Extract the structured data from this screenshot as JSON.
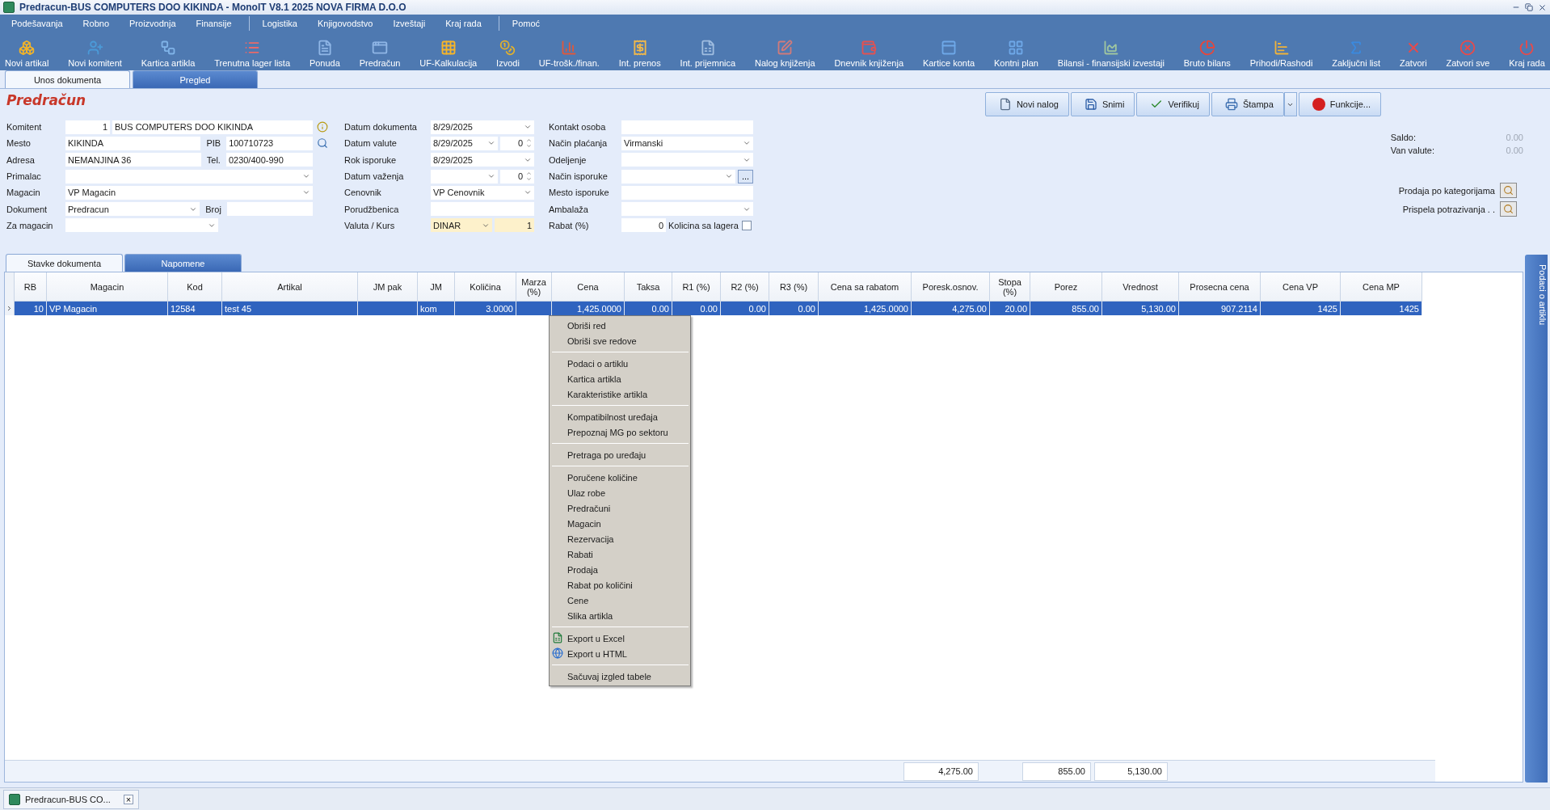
{
  "window": {
    "title": "Predracun-BUS COMPUTERS DOO KIKINDA - MonoIT V8.1 2025 NOVA FIRMA D.O.O"
  },
  "menu": [
    "Podešavanja",
    "Robno",
    "Proizvodnja",
    "Finansije",
    "Logistika",
    "Knjigovodstvo",
    "Izveštaji",
    "Kraj rada",
    "Pomoć"
  ],
  "toolbar": [
    "Novi artikal",
    "Novi komitent",
    "Kartica artikla",
    "Trenutna lager lista",
    "Ponuda",
    "Predračun",
    "UF-Kalkulacija",
    "Izvodi",
    "UF-trošk./finan.",
    "Int. prenos",
    "Int. prijemnica",
    "Nalog knjiženja",
    "Dnevnik knjiženja",
    "Kartice konta",
    "Kontni plan",
    "Bilansi - finansijski izvestaji",
    "Bruto bilans",
    "Prihodi/Rashodi",
    "Zaključni list",
    "Zatvori",
    "Zatvori sve",
    "Kraj rada"
  ],
  "tabs": [
    {
      "label": "Unos dokumenta",
      "selected": true
    },
    {
      "label": "Pregled",
      "selected": false
    }
  ],
  "form": {
    "title": "Predračun",
    "columns": [
      [
        {
          "label": "Komitent",
          "parts": [
            {
              "kind": "number",
              "value": "1",
              "highlighted": false
            },
            {
              "kind": "text",
              "value": "BUS COMPUTERS DOO KIKINDA",
              "highlighted": false
            }
          ]
        },
        {
          "label": "Mesto",
          "parts": [
            {
              "kind": "text",
              "value": "KIKINDA",
              "highlighted": false
            },
            {
              "kind": "label",
              "text": "PIB"
            },
            {
              "kind": "text",
              "value": "100710723",
              "highlighted": false
            }
          ]
        },
        {
          "label": "Adresa",
          "parts": [
            {
              "kind": "text",
              "value": "NEMANJINA 36",
              "highlighted": false
            },
            {
              "kind": "label",
              "text": "Tel."
            },
            {
              "kind": "text",
              "value": "0230/400-990",
              "highlighted": false
            }
          ]
        },
        {
          "label": "Primalac",
          "parts": [
            {
              "kind": "dropdown",
              "highlighted": false
            }
          ]
        },
        {
          "label": "Magacin",
          "parts": [
            {
              "kind": "dropdown",
              "value": "VP Magacin",
              "highlighted": false
            }
          ]
        },
        {
          "label": "Dokument",
          "parts": [
            {
              "kind": "dropdown",
              "value": "Predracun",
              "highlighted": false
            },
            {
              "kind": "label",
              "text": "Broj"
            },
            {
              "kind": "text",
              "highlighted": false
            }
          ]
        },
        {
          "label": "Za magacin",
          "parts": [
            {
              "kind": "dropdown",
              "highlighted": false
            },
            {
              "kind": "gap"
            }
          ]
        }
      ],
      [
        {
          "label": "Datum dokumenta",
          "parts": [
            {
              "kind": "dropdown",
              "value": "8/29/2025",
              "highlighted": false
            }
          ]
        },
        {
          "label": "Datum valute",
          "parts": [
            {
              "kind": "dropdown",
              "value": "8/29/2025",
              "highlighted": false
            },
            {
              "kind": "spinner",
              "value": "0",
              "highlighted": false
            }
          ]
        },
        {
          "label": "Rok isporuke",
          "parts": [
            {
              "kind": "dropdown",
              "value": "8/29/2025",
              "highlighted": false
            }
          ]
        },
        {
          "label": "Datum važenja",
          "parts": [
            {
              "kind": "dropdown",
              "highlighted": false
            },
            {
              "kind": "spinner",
              "value": "0",
              "highlighted": false
            }
          ]
        },
        {
          "label": "Cenovnik",
          "parts": [
            {
              "kind": "dropdown",
              "value": "VP Cenovnik",
              "highlighted": false
            }
          ]
        },
        {
          "label": "Porudžbenica",
          "parts": [
            {
              "kind": "text",
              "highlighted": false
            }
          ]
        },
        {
          "label": "Valuta / Kurs",
          "parts": [
            {
              "kind": "dropdown",
              "value": "DINAR",
              "highlighted": true
            },
            {
              "kind": "number",
              "value": "1",
              "highlighted": true
            }
          ]
        }
      ],
      [
        {
          "label": "Kontakt osoba",
          "parts": [
            {
              "kind": "text",
              "highlighted": false
            }
          ]
        },
        {
          "label": "Način plaćanja",
          "parts": [
            {
              "kind": "dropdown",
              "value": "Virmanski",
              "highlighted": false
            }
          ]
        },
        {
          "label": "Odeljenje",
          "parts": [
            {
              "kind": "dropdown",
              "highlighted": false
            }
          ]
        },
        {
          "label": "Način isporuke",
          "parts": [
            {
              "kind": "dropdown",
              "highlighted": false
            },
            {
              "kind": "button",
              "text": "..."
            }
          ]
        },
        {
          "label": "Mesto isporuke",
          "parts": [
            {
              "kind": "text",
              "highlighted": false
            }
          ]
        },
        {
          "label": "Ambalaža",
          "parts": [
            {
              "kind": "dropdown",
              "highlighted": false
            }
          ]
        },
        {
          "label": "Rabat (%)",
          "parts": [
            {
              "kind": "number",
              "value": "0",
              "highlighted": false
            },
            {
              "kind": "checkbox",
              "text": "Kolicina sa lagera",
              "checked": false
            }
          ]
        }
      ]
    ]
  },
  "actions": [
    "Novi nalog",
    "Snimi",
    "Verifikuj",
    "Štampa",
    "Funkcije..."
  ],
  "balance": [
    {
      "label": "Saldo:",
      "value": "0.00"
    },
    {
      "label": "Van valute:",
      "value": "0.00"
    }
  ],
  "reports": [
    "Prodaja po kategorijama",
    "Prispela potrazivanja . ."
  ],
  "lower_tabs": [
    {
      "label": "Stavke dokumenta",
      "selected": true
    },
    {
      "label": "Napomene",
      "selected": false
    }
  ],
  "table": {
    "columns": [
      "RB",
      "Magacin",
      "Kod",
      "Artikal",
      "JM pak",
      "JM",
      "Količina",
      "Marza (%)",
      "Cena",
      "Taksa",
      "R1 (%)",
      "R2 (%)",
      "R3 (%)",
      "Cena sa rabatom",
      "Poresk.osnov.",
      "Stopa (%)",
      "Porez",
      "Vrednost",
      "Prosecna cena",
      "Cena VP",
      "Cena MP"
    ],
    "rows": [
      {
        "selected": true,
        "cells": [
          "10",
          "VP Magacin",
          "12584",
          "test 45",
          null,
          "kom",
          "3.0000",
          null,
          "1,425.0000",
          "0.00",
          "0.00",
          "0.00",
          "0.00",
          "1,425.0000",
          "4,275.00",
          "20.00",
          "855.00",
          "5,130.00",
          "907.2114",
          "1425",
          "1425"
        ]
      }
    ],
    "totals": [
      "4,275.00",
      "855.00",
      "5,130.00"
    ]
  },
  "context_menu": [
    [
      "Obriši red",
      "Obriši sve redove"
    ],
    [
      "Podaci o artiklu",
      "Kartica artikla",
      "Karakteristike artikla"
    ],
    [
      "Kompatibilnost uređaja",
      "Prepoznaj MG po sektoru"
    ],
    [
      "Pretraga po uređaju"
    ],
    [
      "Poručene količine",
      "Ulaz robe",
      "Predračuni",
      "Magacin",
      "Rezervacija",
      "Rabati",
      "Prodaja",
      "Rabat po količini",
      "Cene",
      "Slika artikla"
    ],
    [
      "Export u Excel",
      "Export u HTML"
    ],
    [
      "Sačuvaj izgled tabele"
    ]
  ],
  "side_tab": "Podaci o artiklu",
  "taskbar": {
    "window": "Predracun-BUS CO...",
    "close": "×"
  }
}
